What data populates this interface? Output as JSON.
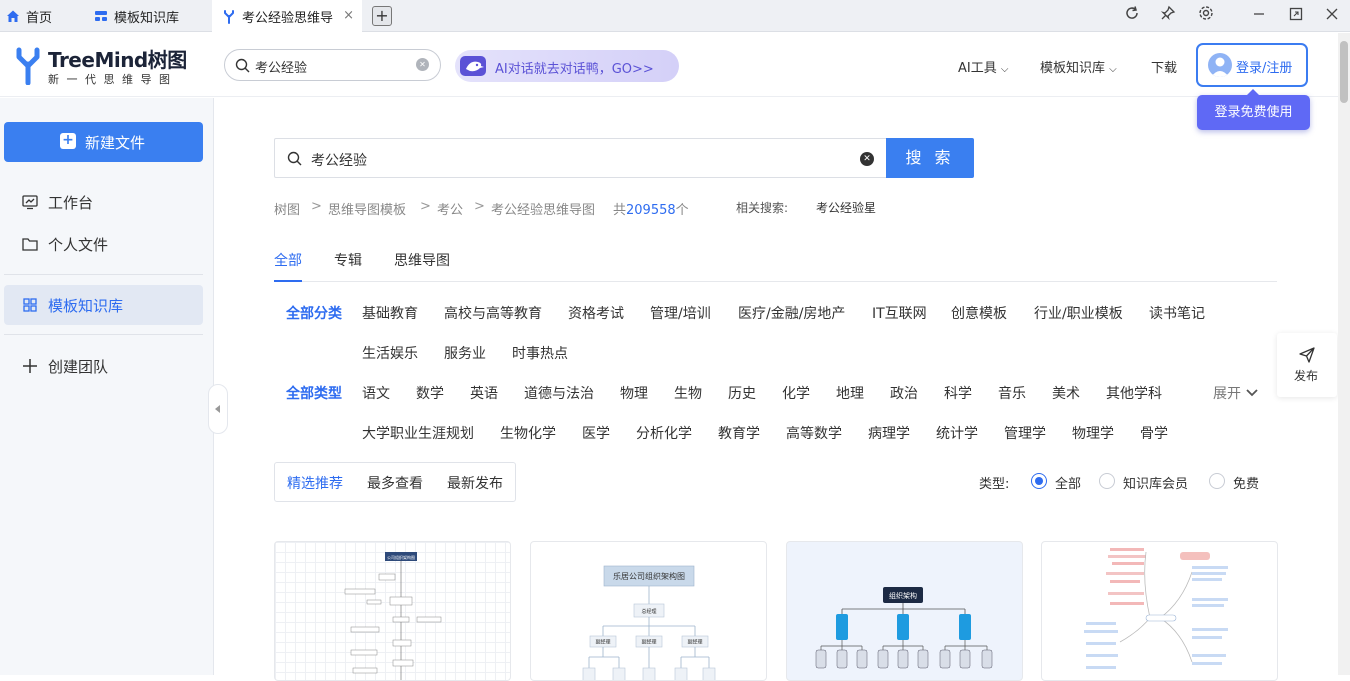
{
  "tabs": [
    {
      "label": "首页",
      "icon": "home-icon"
    },
    {
      "label": "模板知识库",
      "icon": "template-icon"
    },
    {
      "label": "考公经验思维导",
      "icon": "treemind-icon",
      "active": true
    }
  ],
  "tab_close": "×",
  "new_tab": "+",
  "window_controls": [
    "reload-icon",
    "pin-icon",
    "settings-icon",
    "minimize-icon",
    "maximize-icon",
    "close-icon"
  ],
  "brand": {
    "name": "TreeMind树图",
    "tagline": "新一代思维导图",
    "color": "#3a7ff0"
  },
  "header": {
    "search_value": "考公经验",
    "promo": "AI对话就去对话鸭，GO>>",
    "nav": [
      "AI工具",
      "模板知识库",
      "下载"
    ],
    "login": "登录/注册",
    "tooltip": "登录免费使用"
  },
  "sidebar": {
    "new_file": "新建文件",
    "items": [
      "工作台",
      "个人文件",
      "模板知识库",
      "创建团队"
    ]
  },
  "search": {
    "value": "考公经验",
    "button": "搜 索"
  },
  "breadcrumb": {
    "items": [
      "树图",
      "思维导图模板",
      "考公",
      "考公经验思维导图"
    ],
    "sep": ">",
    "total_prefix": "共",
    "total": "209558",
    "total_suffix": "个",
    "related_label": "相关搜索:",
    "related": "考公经验星"
  },
  "subtabs": [
    "全部",
    "专辑",
    "思维导图"
  ],
  "filters": {
    "category_label": "全部分类",
    "categories": [
      "基础教育",
      "高校与高等教育",
      "资格考试",
      "管理/培训",
      "医疗/金融/房地产",
      "IT互联网",
      "创意模板",
      "行业/职业模板",
      "读书笔记",
      "生活娱乐",
      "服务业",
      "时事热点"
    ],
    "type_label": "全部类型",
    "types": [
      "语文",
      "数学",
      "英语",
      "道德与法治",
      "物理",
      "生物",
      "历史",
      "化学",
      "地理",
      "政治",
      "科学",
      "音乐",
      "美术",
      "其他学科",
      "大学职业生涯规划",
      "生物化学",
      "医学",
      "分析化学",
      "教育学",
      "高等数学",
      "病理学",
      "统计学",
      "管理学",
      "物理学",
      "骨学"
    ],
    "expand": "展开"
  },
  "sort": [
    "精选推荐",
    "最多查看",
    "最新发布"
  ],
  "type_filter": {
    "label": "类型:",
    "options": [
      "全部",
      "知识库会员",
      "免费"
    ]
  },
  "publish": "发布",
  "cards": [
    {
      "title": "公司组织架构图"
    },
    {
      "title": "乐居公司组织架构图",
      "node": "总经理",
      "sub": [
        "副经理",
        "副经理",
        "副经理"
      ]
    },
    {
      "title": "组织架构"
    },
    {
      "title": ""
    }
  ]
}
